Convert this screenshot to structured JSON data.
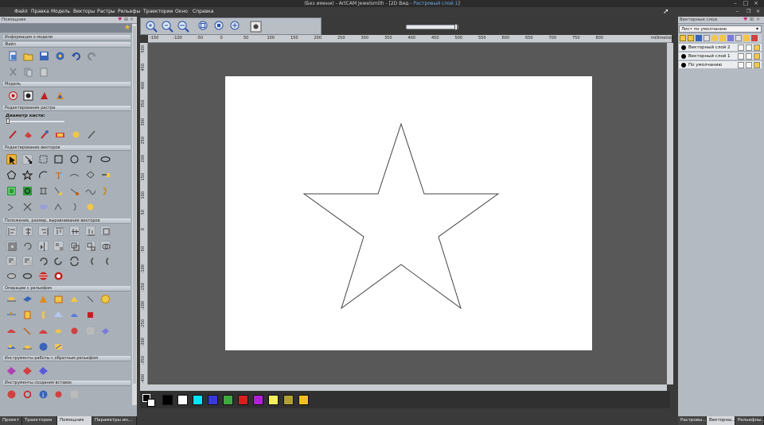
{
  "window": {
    "title_prefix": "(Без имени) - ArtCAM Jewelsmith - [2D Вид - ",
    "title_highlight": "Растровый слой 1",
    "title_suffix": "]"
  },
  "menu": [
    "Файл",
    "Правка",
    "Модель",
    "Векторы",
    "Растры",
    "Рельефы",
    "Траектории",
    "Окно",
    "Справка"
  ],
  "left_panel": {
    "title": "Помощник",
    "sections": {
      "model_info": "Информация о модели",
      "file": "Файл",
      "model": "Модель",
      "raster_edit": "Редактирование растра",
      "brush_label": "Диаметр кисти:",
      "vector_edit": "Редактирование векторов",
      "vector_pos": "Положение, размер, выравнивание векторов",
      "relief_ops": "Операции с рельефом",
      "relief_tools": "Инструменты работы с обратным рельефом",
      "insert_tools": "Инструменты создания вставок"
    },
    "tabs": [
      "Проект",
      "Траектории",
      "Помощник",
      "Параметры ин..."
    ],
    "active_tab": "Помощник"
  },
  "ruler": {
    "h_labels": [
      "-150",
      "-100",
      "-50",
      "0",
      "50",
      "100",
      "150",
      "200",
      "250",
      "300",
      "350",
      "400",
      "450",
      "500",
      "550",
      "600",
      "650",
      "700",
      "750",
      "800"
    ],
    "unit": "millimetres",
    "v_labels": [
      "500",
      "450",
      "400",
      "350",
      "300",
      "250",
      "200",
      "150",
      "100",
      "50",
      "0",
      "-50",
      "-100",
      "-150",
      "-200",
      "-250",
      "-300",
      "-350",
      "-400"
    ]
  },
  "palette": [
    "#000000",
    "#ffffff",
    "#00e5ff",
    "#3a3ad8",
    "#40a840",
    "#d81e1e",
    "#b020d8",
    "#f2f060",
    "#b0a030",
    "#f2c020"
  ],
  "right_panel": {
    "title": "Векторные слои",
    "select_value": "Лист по умолчанию",
    "layers": [
      "Векторный слой 2",
      "Векторный слой 1",
      "По умолчанию"
    ],
    "tabs": [
      "Растровы...",
      "Векторны...",
      "Рельефны..."
    ],
    "active_tab": "Векторны..."
  },
  "accent": "#f0b23a"
}
